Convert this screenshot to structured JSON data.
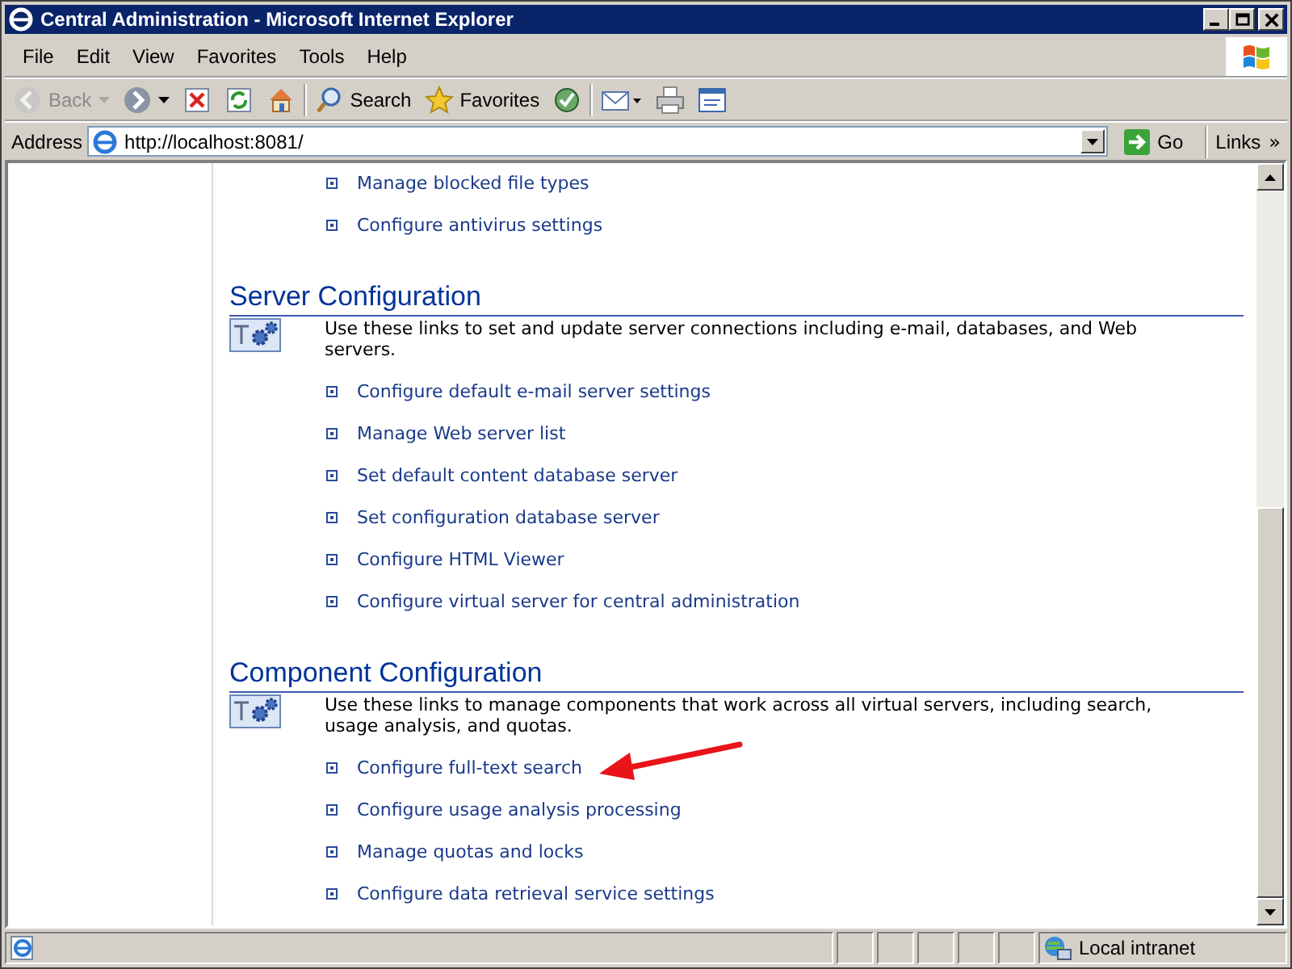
{
  "window": {
    "title": "Central Administration - Microsoft Internet Explorer"
  },
  "menu": [
    "File",
    "Edit",
    "View",
    "Favorites",
    "Tools",
    "Help"
  ],
  "toolbar": [
    {
      "kind": "back",
      "label": "Back",
      "disabled": true
    },
    {
      "kind": "forward",
      "disabled": false
    },
    {
      "kind": "stop",
      "disabled": false
    },
    {
      "kind": "refresh",
      "disabled": false
    },
    {
      "kind": "home",
      "disabled": false
    },
    {
      "kind": "search",
      "label": "Search",
      "disabled": false
    },
    {
      "kind": "favorites",
      "label": "Favorites",
      "disabled": false
    },
    {
      "kind": "media",
      "disabled": false
    },
    {
      "kind": "mail",
      "disabled": false
    },
    {
      "kind": "print",
      "disabled": false
    },
    {
      "kind": "edit",
      "disabled": false
    }
  ],
  "address": {
    "label": "Address",
    "value": "http://localhost:8081/",
    "go": "Go",
    "links": "Links",
    "more": "»"
  },
  "sections": [
    {
      "links": [
        "Manage blocked file types",
        "Configure antivirus settings"
      ]
    },
    {
      "title": "Server Configuration",
      "description": "Use these links to set and update server connections including e-mail, databases, and Web servers.",
      "links": [
        "Configure default e-mail server settings",
        "Manage Web server list",
        "Set default content database server",
        "Set configuration database server",
        "Configure HTML Viewer",
        "Configure virtual server for central administration"
      ]
    },
    {
      "title": "Component Configuration",
      "description": "Use these links to manage components that work across all virtual servers, including search, usage analysis, and quotas.",
      "links": [
        "Configure full-text search",
        "Configure usage analysis processing",
        "Manage quotas and locks",
        "Configure data retrieval service settings"
      ]
    }
  ],
  "status_bar": {
    "zone": "Local intranet"
  }
}
